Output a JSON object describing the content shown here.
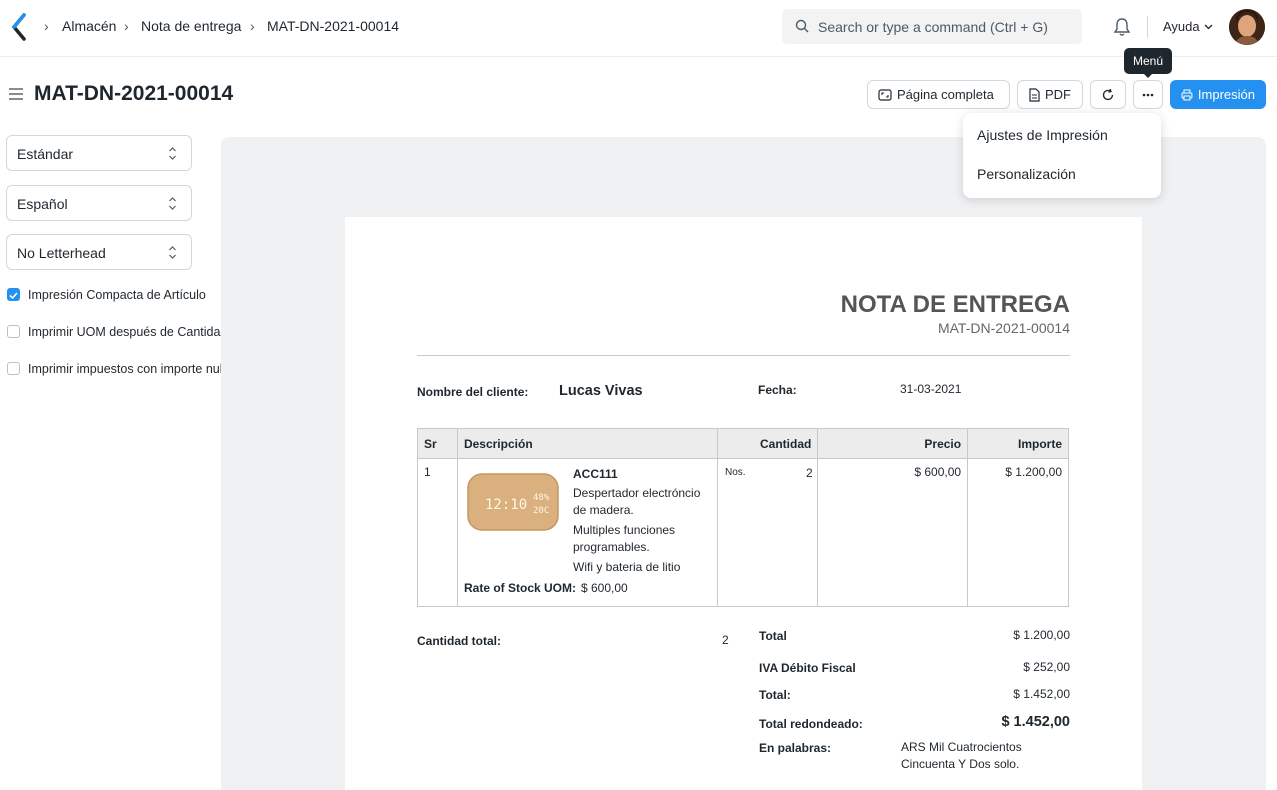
{
  "navbar": {
    "breadcrumbs": [
      "Almacén",
      "Nota de entrega",
      "MAT-DN-2021-00014"
    ],
    "search_placeholder": "Search or type a command (Ctrl + G)",
    "help_label": "Ayuda"
  },
  "page": {
    "title": "MAT-DN-2021-00014",
    "buttons": {
      "full_page": "Página completa",
      "pdf": "PDF",
      "print": "Impresión"
    },
    "tooltip": "Menú",
    "menu_items": [
      "Ajustes de Impresión",
      "Personalización"
    ]
  },
  "sidebar": {
    "format": "Estándar",
    "language": "Español",
    "letterhead": "No Letterhead",
    "options": [
      {
        "label": "Impresión Compacta de Artículo",
        "checked": true
      },
      {
        "label": "Imprimir UOM después de Cantidad",
        "checked": false
      },
      {
        "label": "Imprimir impuestos con importe nulo",
        "checked": false
      }
    ]
  },
  "document": {
    "title": "NOTA DE ENTREGA",
    "number": "MAT-DN-2021-00014",
    "customer_label": "Nombre del cliente:",
    "customer_name": "Lucas Vivas",
    "date_label": "Fecha:",
    "date": "31-03-2021",
    "columns": [
      "Sr",
      "Descripción",
      "Cantidad",
      "Precio",
      "Importe"
    ],
    "item": {
      "sr": "1",
      "code": "ACC111",
      "desc_lines": [
        "Despertador electróncio",
        "de madera.",
        "Multiples funciones",
        "programables.",
        "Wifi y bateria de litio"
      ],
      "rate_label": "Rate of Stock UOM:",
      "rate_value": "$ 600,00",
      "uom": "Nos.",
      "qty": "2",
      "price": "$ 600,00",
      "amount": "$ 1.200,00",
      "clock_left": "12:10",
      "clock_top_right": "48%",
      "clock_bottom_right": "20C"
    },
    "total_qty_label": "Cantidad total:",
    "total_qty": "2",
    "totals": {
      "total_label": "Total",
      "total_value": "$ 1.200,00",
      "tax_label": "IVA Débito Fiscal",
      "tax_value": "$ 252,00",
      "grand_label": "Total:",
      "grand_value": "$ 1.452,00",
      "rounded_label": "Total redondeado:",
      "rounded_value": "$ 1.452,00",
      "words_label": "En palabras:",
      "words_line1": "ARS Mil Cuatrocientos",
      "words_line2": "Cincuenta Y Dos solo."
    }
  },
  "colors": {
    "primary": "#2490ef",
    "text": "#1f272e",
    "preview_bg": "#eff1f3"
  }
}
